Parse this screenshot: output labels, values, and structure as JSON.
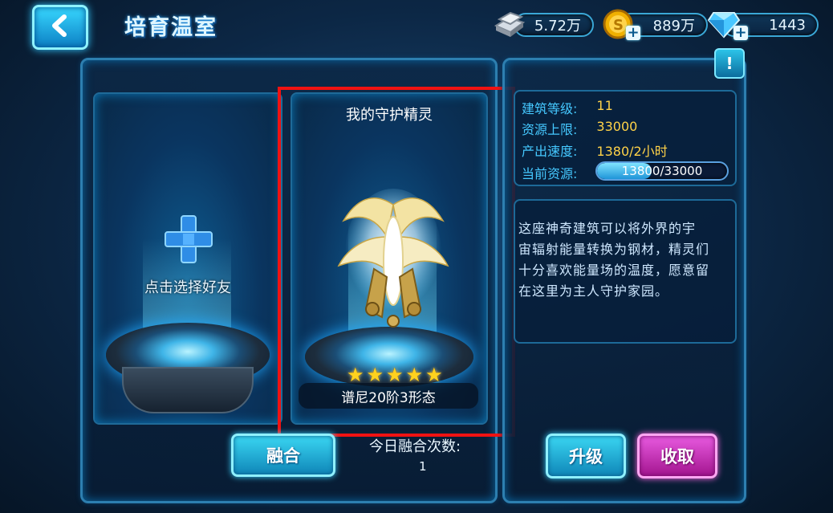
{
  "header": {
    "title": "培育温室",
    "back_icon": "chevron-left-icon"
  },
  "resources": {
    "steel": {
      "icon": "steel-ingot-icon",
      "value": "5.72万"
    },
    "gold": {
      "icon": "gold-coin-icon",
      "value": "889万",
      "plus": "+"
    },
    "diamond": {
      "icon": "diamond-icon",
      "value": "1443",
      "plus": "+"
    }
  },
  "left_panel": {
    "friend_slot": {
      "label": "点击选择好友",
      "plus_icon": "add-plus-icon"
    },
    "my_spirit": {
      "title": "我的守护精灵",
      "stars": 5,
      "name": "谱尼20阶3形态"
    },
    "fuse_button": "融合",
    "fuse_count_label": "今日融合次数:",
    "fuse_count_value": "1"
  },
  "right_panel": {
    "info_button": "!",
    "info": [
      {
        "label": "建筑等级:",
        "value": "11"
      },
      {
        "label": "资源上限:",
        "value": "33000"
      },
      {
        "label": "产出速度:",
        "value": "1380/2小时"
      }
    ],
    "current_resource": {
      "label": "当前资源:",
      "text": "13800/33000",
      "current": 13800,
      "max": 33000
    },
    "description_lines": [
      "这座神奇建筑可以将外界的宇",
      "宙辐射能量转换为钢材，精灵们",
      "十分喜欢能量场的温度，愿意留",
      "在这里为主人守护家园。"
    ],
    "upgrade_button": "升级",
    "collect_button": "收取"
  },
  "colors": {
    "info_label": "#45c8ff",
    "info_value": "#ffd248",
    "highlight": "#f01212",
    "star": "#ffd21e"
  }
}
